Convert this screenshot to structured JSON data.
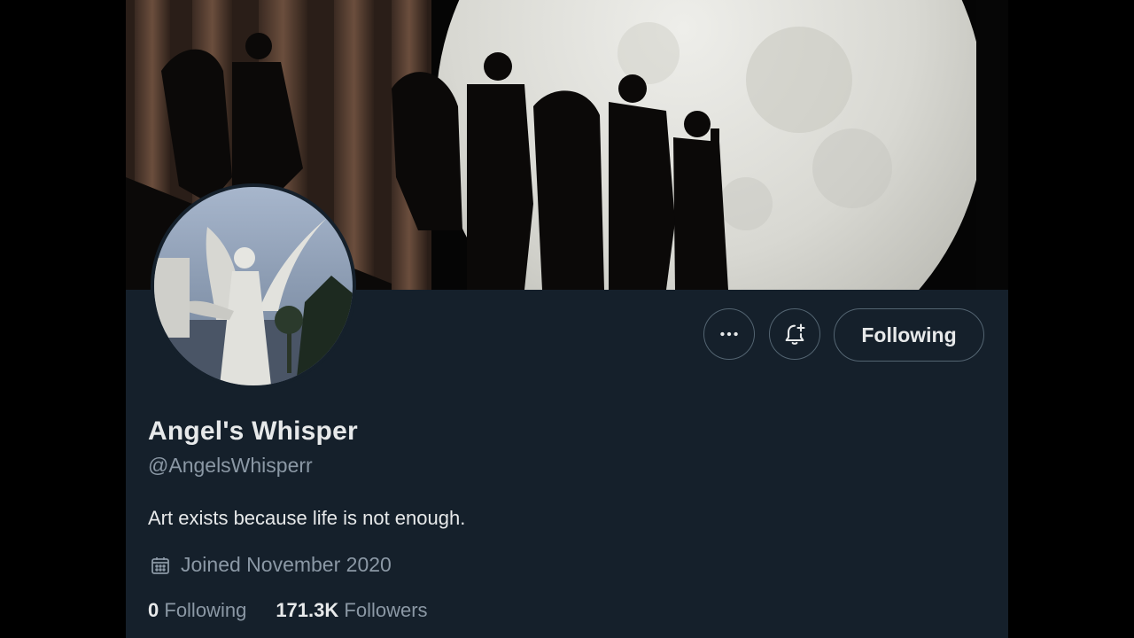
{
  "profile": {
    "display_name": "Angel's Whisper",
    "handle": "@AngelsWhisperr",
    "bio": "Art exists because life is not enough.",
    "joined": "Joined November 2020",
    "following_count": "0",
    "following_label": "Following",
    "followers_count": "171.3K",
    "followers_label": "Followers"
  },
  "actions": {
    "more_icon": "more-horizontal-icon",
    "notify_icon": "bell-plus-icon",
    "follow_button_label": "Following"
  },
  "icons": {
    "joined": "calendar-icon"
  },
  "colors": {
    "background": "#15202b",
    "primary_text": "#e7e9ea",
    "secondary_text": "#8b98a5",
    "button_border": "#536471"
  }
}
